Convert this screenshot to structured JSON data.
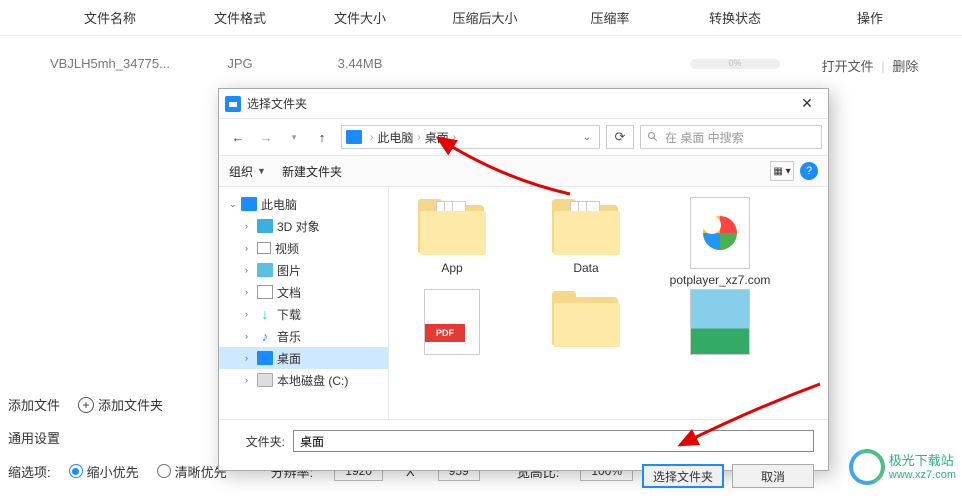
{
  "table": {
    "headers": {
      "name": "文件名称",
      "format": "文件格式",
      "size": "文件大小",
      "compressed": "压缩后大小",
      "ratio": "压缩率",
      "status": "转换状态",
      "action": "操作"
    },
    "row": {
      "name": "VBJLH5mh_34775...",
      "format": "JPG",
      "size": "3.44MB",
      "progress": "0%",
      "open": "打开文件",
      "delete": "删除"
    }
  },
  "dialog": {
    "title": "选择文件夹",
    "breadcrumb": {
      "root": "此电脑",
      "current": "桌面"
    },
    "search_placeholder": "在 桌面 中搜索",
    "toolbar": {
      "organize": "组织",
      "new_folder": "新建文件夹"
    },
    "tree": {
      "pc": "此电脑",
      "objects3d": "3D 对象",
      "video": "视频",
      "pictures": "图片",
      "documents": "文档",
      "downloads": "下载",
      "music": "音乐",
      "desktop": "桌面",
      "localdisk": "本地磁盘 (C:)"
    },
    "files": {
      "app": "App",
      "data": "Data",
      "potplayer": "potplayer_xz7.com",
      "pdf": "PDF"
    },
    "path_label": "文件夹:",
    "path_value": "桌面",
    "select_btn": "选择文件夹",
    "cancel_btn": "取消"
  },
  "settings": {
    "add_file": "添加文件",
    "add_folder": "添加文件夹",
    "general": "通用设置",
    "shrink_label": "缩选项:",
    "shrink_priority": "缩小优先",
    "clarity_priority": "清晰优先",
    "resolution": "分辨率:",
    "width": "1920",
    "height": "959",
    "aspect": "宽高比:",
    "aspect_val": "100%",
    "dim_x": "X"
  },
  "watermark": {
    "name": "极光下载站",
    "url": "www.xz7.com"
  }
}
